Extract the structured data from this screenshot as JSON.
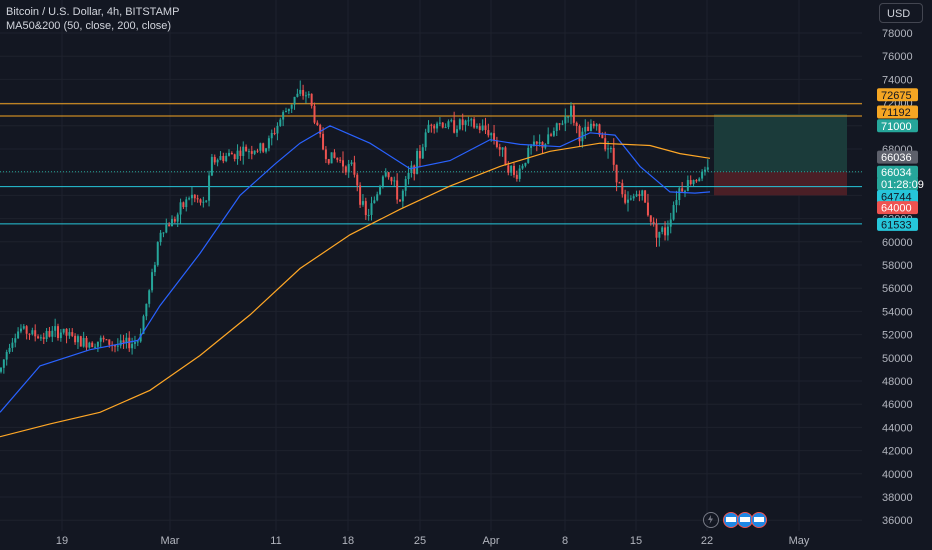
{
  "legend": {
    "symbol_line": "Bitcoin / U.S. Dollar, 4h, BITSTAMP",
    "indicator_line": "MA50&200 (50, close, 200, close)"
  },
  "currency_button": "USD",
  "icons": [
    "lightning-icon",
    "flag-icon-1",
    "flag-icon-2",
    "flag-icon-3"
  ],
  "colors": {
    "background": "#131722",
    "up": "#26a69a",
    "down": "#ef5350",
    "ma50": "#2962ff",
    "ma200": "#ffa726",
    "resistance": "#f5a623",
    "support": "#26c6da",
    "target_zone": "#1b3b3a",
    "stop_zone": "#4a1f26"
  },
  "chart_data": {
    "type": "candlestick",
    "symbol": "Bitcoin / U.S. Dollar",
    "interval": "4h",
    "exchange": "BITSTAMP",
    "x_ticks": [
      "19",
      "Mar",
      "11",
      "18",
      "25",
      "Apr",
      "8",
      "15",
      "22",
      "May"
    ],
    "y_ticks": [
      36000,
      38000,
      40000,
      42000,
      44000,
      46000,
      48000,
      50000,
      52000,
      54000,
      56000,
      58000,
      60000,
      62000,
      64000,
      66000,
      68000,
      70000,
      72000,
      74000,
      76000,
      78000
    ],
    "ylim": [
      35200,
      80200
    ],
    "price_path": [
      [
        0,
        48800
      ],
      [
        10,
        51500
      ],
      [
        20,
        52500
      ],
      [
        40,
        51800
      ],
      [
        60,
        52300
      ],
      [
        80,
        51300
      ],
      [
        100,
        51500
      ],
      [
        120,
        51000
      ],
      [
        138,
        51500
      ],
      [
        150,
        56000
      ],
      [
        160,
        61000
      ],
      [
        175,
        62000
      ],
      [
        190,
        64000
      ],
      [
        205,
        63000
      ],
      [
        212,
        67000
      ],
      [
        230,
        67500
      ],
      [
        250,
        68000
      ],
      [
        265,
        68000
      ],
      [
        280,
        70500
      ],
      [
        295,
        72500
      ],
      [
        308,
        72800
      ],
      [
        315,
        70500
      ],
      [
        325,
        67500
      ],
      [
        340,
        67000
      ],
      [
        355,
        66000
      ],
      [
        365,
        62000
      ],
      [
        375,
        63500
      ],
      [
        385,
        66500
      ],
      [
        400,
        63500
      ],
      [
        410,
        66000
      ],
      [
        420,
        67500
      ],
      [
        430,
        70500
      ],
      [
        450,
        70000
      ],
      [
        465,
        70200
      ],
      [
        490,
        69500
      ],
      [
        500,
        68000
      ],
      [
        515,
        65500
      ],
      [
        530,
        68000
      ],
      [
        545,
        68500
      ],
      [
        560,
        70000
      ],
      [
        570,
        71500
      ],
      [
        580,
        69000
      ],
      [
        595,
        70000
      ],
      [
        610,
        68000
      ],
      [
        625,
        63000
      ],
      [
        640,
        64500
      ],
      [
        655,
        61000
      ],
      [
        665,
        60800
      ],
      [
        678,
        64500
      ],
      [
        695,
        65500
      ],
      [
        708,
        66000
      ]
    ],
    "series": [
      {
        "name": "MA50",
        "path": [
          [
            0,
            45300
          ],
          [
            40,
            49300
          ],
          [
            90,
            50700
          ],
          [
            138,
            51500
          ],
          [
            160,
            54500
          ],
          [
            200,
            59000
          ],
          [
            240,
            64000
          ],
          [
            275,
            66700
          ],
          [
            300,
            68500
          ],
          [
            330,
            70000
          ],
          [
            370,
            68500
          ],
          [
            410,
            66300
          ],
          [
            450,
            67000
          ],
          [
            490,
            68800
          ],
          [
            520,
            68400
          ],
          [
            560,
            68200
          ],
          [
            590,
            69400
          ],
          [
            615,
            69200
          ],
          [
            640,
            66500
          ],
          [
            670,
            64300
          ],
          [
            695,
            64200
          ],
          [
            710,
            64300
          ]
        ]
      },
      {
        "name": "MA200",
        "path": [
          [
            0,
            43200
          ],
          [
            50,
            44300
          ],
          [
            100,
            45300
          ],
          [
            150,
            47200
          ],
          [
            200,
            50200
          ],
          [
            250,
            53700
          ],
          [
            300,
            57700
          ],
          [
            350,
            60600
          ],
          [
            400,
            62800
          ],
          [
            450,
            64800
          ],
          [
            500,
            66500
          ],
          [
            550,
            67800
          ],
          [
            600,
            68500
          ],
          [
            650,
            68300
          ],
          [
            680,
            67600
          ],
          [
            710,
            67200
          ]
        ]
      }
    ],
    "horizontal_levels": [
      {
        "value": 71900,
        "color": "#f5a623"
      },
      {
        "value": 70850,
        "color": "#f5a623"
      },
      {
        "value": 64760,
        "color": "#26c6da"
      },
      {
        "value": 61550,
        "color": "#26c6da"
      }
    ],
    "position_tool": {
      "entry": 66034,
      "target": 71000,
      "stop": 64000
    },
    "price_labels": [
      {
        "text": "72675",
        "value": 72675,
        "bg": "#f5a623",
        "fg": "#131722"
      },
      {
        "text": "71192",
        "value": 71192,
        "bg": "#f5a623",
        "fg": "#131722"
      },
      {
        "text": "71000",
        "value": 70000,
        "bg": "#26a69a",
        "fg": "#ffffff"
      },
      {
        "text": "66036",
        "value": 67300,
        "bg": "#5d606b",
        "fg": "#ffffff"
      },
      {
        "text": "66034",
        "value": 66000,
        "bg": "#26a69a",
        "fg": "#ffffff"
      },
      {
        "text": "01:28:09",
        "value": 65000,
        "bg": "#26a69a",
        "fg": "#ffffff"
      },
      {
        "text": "64744",
        "value": 63900,
        "bg": "#26c6da",
        "fg": "#131722"
      },
      {
        "text": "64000",
        "value": 62950,
        "bg": "#ef5350",
        "fg": "#ffffff"
      },
      {
        "text": "61533",
        "value": 61500,
        "bg": "#26c6da",
        "fg": "#131722"
      }
    ]
  }
}
